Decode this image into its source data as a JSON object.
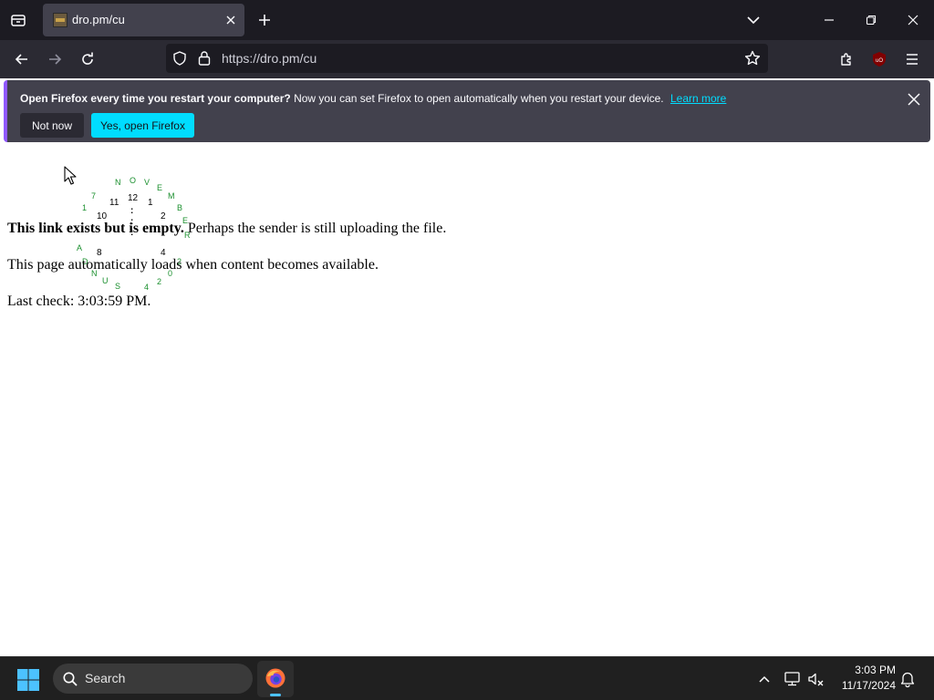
{
  "browser": {
    "tab_title": "dro.pm/cu",
    "url": "https://dro.pm/cu"
  },
  "notification": {
    "title": "Open Firefox every time you restart your computer?",
    "message": "Now you can set Firefox to open automatically when you restart your device.",
    "learn_more": "Learn more",
    "not_now": "Not now",
    "yes_open": "Yes, open Firefox"
  },
  "clock_widget": {
    "numbers": [
      "12",
      "1",
      "2",
      "4",
      "8",
      "10",
      "11"
    ],
    "colon": ":",
    "ring_letters": [
      "N",
      "O",
      "V",
      "E",
      "M",
      "B",
      "E",
      "R",
      "7",
      "1",
      "A",
      "D",
      "N",
      "U",
      "S",
      "4",
      "2",
      "0",
      "2"
    ]
  },
  "page": {
    "line1_bold": "This link exists but is empty.",
    "line1_rest": " Perhaps the sender is still uploading the file.",
    "line2": "This page automatically loads when content becomes available.",
    "line3": "Last check: 3:03:59 PM."
  },
  "taskbar": {
    "search_label": "Search",
    "time": "3:03 PM",
    "date": "11/17/2024"
  },
  "colors": {
    "accent": "#00ddff",
    "notification_bar": "#9059ff",
    "clock_green": "#1a8f2e"
  },
  "icons": [
    "tab-list-icon",
    "close-icon",
    "plus-icon",
    "chevron-down-icon",
    "minimize-icon",
    "restore-icon",
    "back-icon",
    "forward-icon",
    "reload-icon",
    "shield-icon",
    "lock-icon",
    "star-icon",
    "extensions-icon",
    "ublock-icon",
    "menu-icon",
    "windows-icon",
    "search-icon",
    "firefox-icon",
    "chevron-up-icon",
    "network-icon",
    "volume-icon",
    "bell-icon"
  ]
}
